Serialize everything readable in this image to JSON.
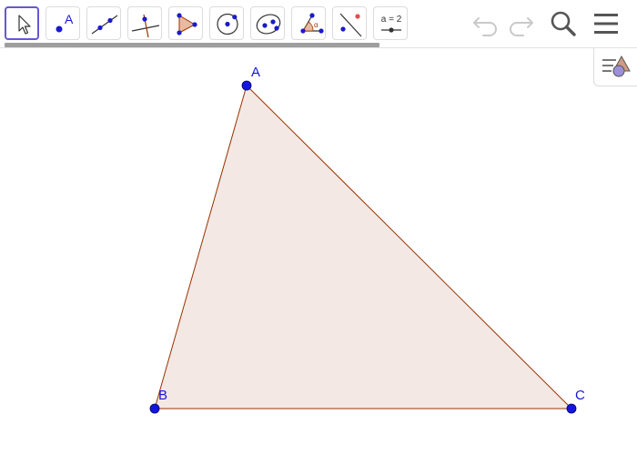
{
  "toolbar": {
    "tools": [
      {
        "name": "move",
        "icon": "move-arrow-icon",
        "selected": true
      },
      {
        "name": "point",
        "icon": "point-icon",
        "label": "A"
      },
      {
        "name": "line",
        "icon": "line-icon"
      },
      {
        "name": "perpendicular-line",
        "icon": "perpendicular-line-icon"
      },
      {
        "name": "polygon",
        "icon": "polygon-icon"
      },
      {
        "name": "circle-center-point",
        "icon": "circle-with-center-icon"
      },
      {
        "name": "ellipse",
        "icon": "ellipse-icon"
      },
      {
        "name": "angle",
        "icon": "angle-icon",
        "label": "α"
      },
      {
        "name": "reflect-about-line",
        "icon": "reflect-icon"
      },
      {
        "name": "slider",
        "icon": "slider-icon",
        "label": "a = 2"
      }
    ],
    "header_buttons": [
      "undo-icon",
      "redo-icon",
      "search-icon",
      "menu-icon"
    ],
    "undo_enabled": false,
    "redo_enabled": false
  },
  "style_bar_toggle": {
    "icon": "style-bar-toggle-icon"
  },
  "construction": {
    "points": [
      {
        "name": "A"
      },
      {
        "name": "B"
      },
      {
        "name": "C"
      }
    ],
    "polygon": {
      "vertices": [
        "A",
        "B",
        "C"
      ],
      "fill_color": "#f3e8e4",
      "stroke_color": "#993300"
    },
    "point_color": "#1515e0",
    "label_color": "#1515e0"
  },
  "colors": {
    "accent_selected": "#6557d2",
    "toolbar_scrollbar": "#9e9e9e",
    "icon_disabled": "#c9c9c9",
    "icon_enabled": "#555555"
  }
}
